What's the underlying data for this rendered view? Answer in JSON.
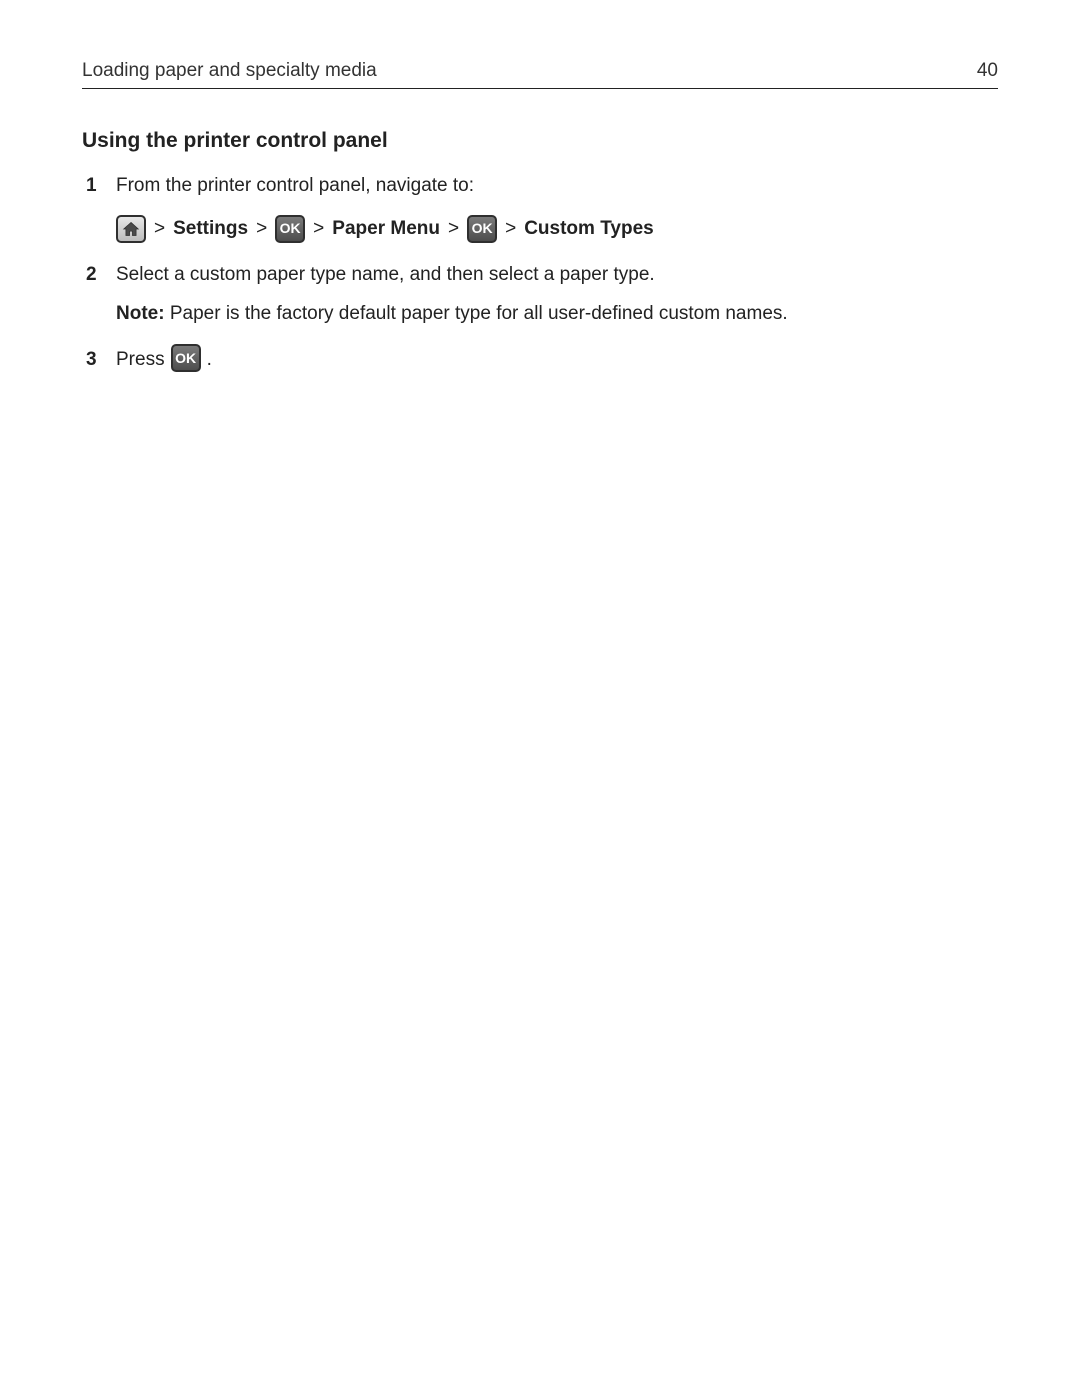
{
  "header": {
    "title": "Loading paper and specialty media",
    "page_number": "40"
  },
  "section": {
    "title": "Using the printer control panel"
  },
  "steps": {
    "s1": {
      "text": "From the printer control panel, navigate to:",
      "nav": {
        "sep1": ">",
        "settings": "Settings",
        "sep2": ">",
        "ok1": "OK",
        "sep3": ">",
        "paper_menu": "Paper Menu",
        "sep4": ">",
        "ok2": "OK",
        "sep5": ">",
        "custom_types": "Custom Types"
      }
    },
    "s2": {
      "text": "Select a custom paper type name, and then select a paper type.",
      "note_label": "Note:",
      "note_text": " Paper is the factory default paper type for all user-defined custom names."
    },
    "s3": {
      "text_before": "Press ",
      "ok": "OK",
      "text_after": "."
    }
  }
}
